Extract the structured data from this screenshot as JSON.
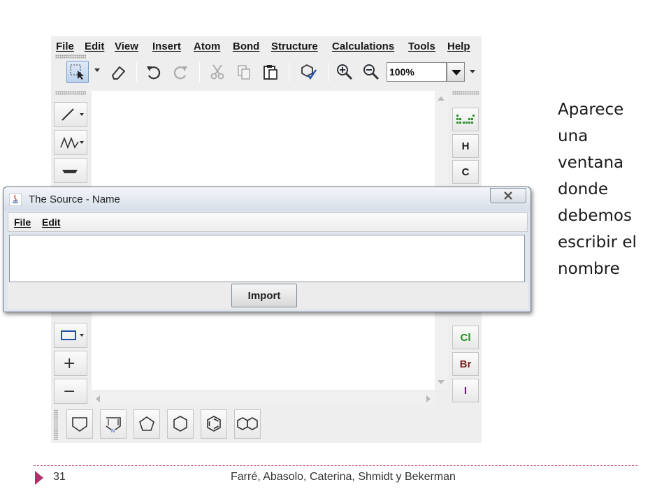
{
  "editor": {
    "menu": [
      "File",
      "Edit",
      "View",
      "Insert",
      "Atom",
      "Bond",
      "Structure",
      "Calculations",
      "Tools",
      "Help"
    ],
    "zoom_value": "100%",
    "atom_buttons": [
      {
        "label": "H",
        "color": "#1a1a1a"
      },
      {
        "label": "C",
        "color": "#1a1a1a"
      },
      {
        "label": "Cl",
        "color": "#1f8f1f"
      },
      {
        "label": "Br",
        "color": "#7a2323"
      },
      {
        "label": "I",
        "color": "#6b1f7a"
      }
    ],
    "left_buttons": {
      "plus": "+",
      "minus": "−"
    },
    "icons": {
      "toolbar": [
        "select-arrow-icon",
        "eraser-icon",
        "undo-icon",
        "redo-icon",
        "cut-icon",
        "copy-icon",
        "paste-icon",
        "clean-icon",
        "zoom-in-icon",
        "zoom-out-icon"
      ],
      "bottom": [
        "pentagon-template-icon",
        "pyrrole-template-icon",
        "cyclopentane-icon",
        "cyclohexane-icon",
        "benzene-icon",
        "naphthalene-icon"
      ]
    }
  },
  "dialog": {
    "title": "The Source - Name",
    "menu": [
      "File",
      "Edit"
    ],
    "input_value": "",
    "import_label": "Import"
  },
  "caption_lines": [
    "Aparece",
    "una",
    "ventana",
    "donde",
    "debemos",
    "escribir el",
    "nombre"
  ],
  "footer": {
    "page_number": "31",
    "authors": "Farré, Abasolo, Caterina, Shmidt y Bekerman"
  },
  "colors": {
    "accent_marker": "#b1306a",
    "divider": "#c0457c"
  }
}
